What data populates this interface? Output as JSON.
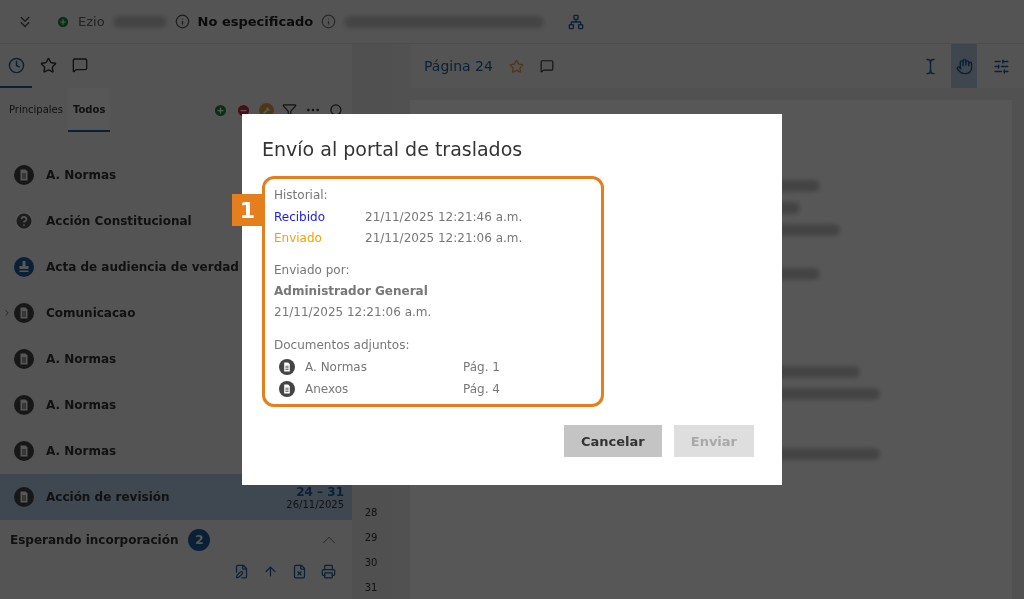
{
  "topbar": {
    "user": "Ezio",
    "status": "No especificado"
  },
  "left_panel": {
    "tabs": [
      {
        "kind": "recent",
        "selected": true
      },
      {
        "kind": "favorites",
        "selected": false
      },
      {
        "kind": "comments",
        "selected": false
      }
    ],
    "subtabs": [
      {
        "label": "Principales",
        "selected": false
      },
      {
        "label": "Todos",
        "selected": true
      }
    ],
    "items": [
      {
        "kind": "document",
        "label": "A. Normas",
        "selected": false
      },
      {
        "kind": "question",
        "label": "Acción Constitucional",
        "selected": false
      },
      {
        "kind": "stamp",
        "label": "Acta de audiencia de verdad",
        "selected": false
      },
      {
        "kind": "document",
        "label": "Comunicacao",
        "selected": false,
        "expanded": false
      },
      {
        "kind": "document",
        "label": "A. Normas",
        "selected": false
      },
      {
        "kind": "document",
        "label": "A. Normas",
        "selected": false
      },
      {
        "kind": "document",
        "label": "A. Normas",
        "selected": false
      },
      {
        "kind": "document",
        "label": "Acción de revisión",
        "selected": true,
        "pages": "24 – 31",
        "date": "26/11/2025"
      }
    ],
    "section": {
      "title": "Esperando incorporación",
      "count": "2",
      "expanded": true
    }
  },
  "line_numbers": [
    "28",
    "29",
    "30",
    "31"
  ],
  "viewer": {
    "page_label": "Página 24",
    "tools": [
      {
        "kind": "select",
        "selected": false
      },
      {
        "kind": "hand",
        "selected": true
      }
    ]
  },
  "dialog": {
    "title": "Envío al portal de traslados",
    "callout": "1",
    "history_label": "Historial:",
    "history": [
      {
        "status": "Recibido",
        "time": "21/11/2025 12:21:46 a.m.",
        "color": "#1a1aee"
      },
      {
        "status": "Enviado",
        "time": "21/11/2025 12:21:06 a.m.",
        "color": "#f5a200"
      }
    ],
    "sent_by_label": "Enviado por:",
    "sent_by": "Administrador General",
    "sent_time": "21/11/2025 12:21:06 a.m.",
    "attachments_label": "Documentos adjuntos:",
    "attachments": [
      {
        "name": "A. Normas",
        "page": "Pág. 1"
      },
      {
        "name": "Anexos",
        "page": "Pág. 4"
      }
    ],
    "buttons": [
      {
        "label": "Cancelar",
        "disabled": false
      },
      {
        "label": "Enviar",
        "disabled": true
      }
    ]
  }
}
